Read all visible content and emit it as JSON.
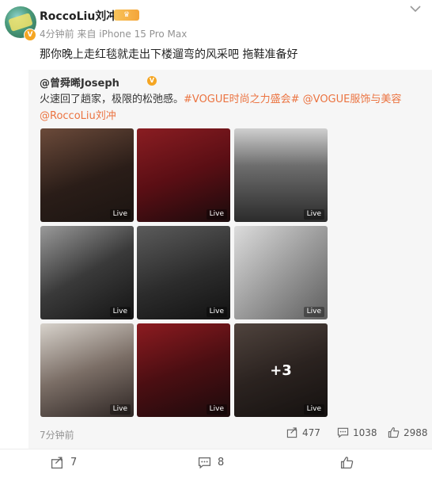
{
  "user": {
    "name": "RoccoLiu刘冲",
    "badge": "V",
    "crown_label": "♛",
    "meta": "4分钟前 来自 iPhone 15 Pro Max"
  },
  "post": {
    "text": "那你晚上走红毯就走出下楼遛弯的风采吧 拖鞋准备好"
  },
  "repost": {
    "author": "@曾舜晞Joseph",
    "badge": "V",
    "text_plain": "火速回了趟家，极限的松弛感。",
    "tag1": "#VOGUE时尚之力盛会#",
    "mention1": "@VOGUE服饰与美容",
    "mention2": "@RoccoLiu刘冲",
    "live_label": "Live",
    "more_count": "+3",
    "time": "7分钟前",
    "stats": {
      "shares": "477",
      "comments": "1038",
      "likes": "2988"
    }
  },
  "toolbar": {
    "share_count": "7",
    "comment_count": "8",
    "like_count": ""
  },
  "colors": {
    "accent": "#eb7340",
    "verified": "#f5a623"
  }
}
